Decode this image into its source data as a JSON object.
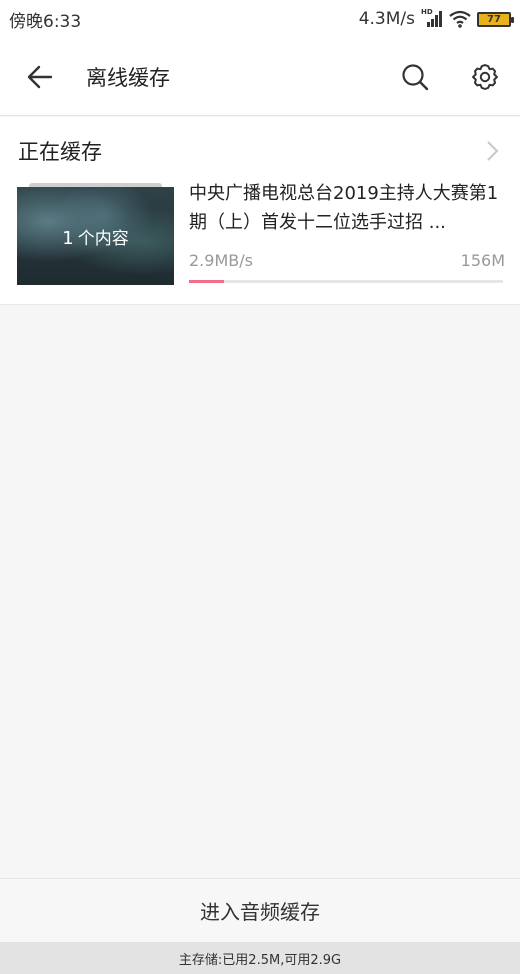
{
  "status_bar": {
    "time": "傍晚6:33",
    "net_speed": "4.3M/s",
    "signal_badge": "HD",
    "battery_level": "77"
  },
  "toolbar": {
    "title": "离线缓存",
    "icons": {
      "back": "back-arrow-icon",
      "search": "search-icon",
      "settings": "gear-icon"
    }
  },
  "downloading": {
    "section_title": "正在缓存",
    "item": {
      "count_number": "1",
      "count_suffix": "个内容",
      "title": "中央广播电视总台2019主持人大赛第1期（上）首发十二位选手过招 ...",
      "speed": "2.9MB/s",
      "size": "156M",
      "progress": 0.11
    }
  },
  "bottom": {
    "audio_cache_label": "进入音频缓存",
    "storage_text": "主存储:已用2.5M,可用2.9G"
  },
  "colors": {
    "progress_fill": "#f06d8b",
    "battery": "#e7b21c"
  }
}
